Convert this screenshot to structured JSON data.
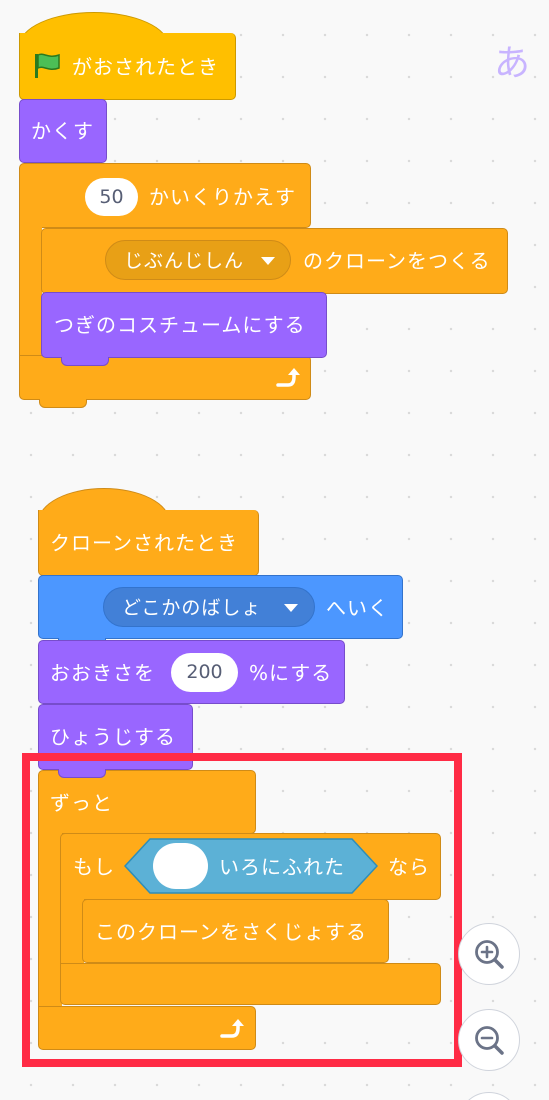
{
  "language_icon": "あ",
  "script1": {
    "flag_hat": {
      "icon": "green-flag-icon",
      "label": "がおされたとき"
    },
    "hide": "かくす",
    "repeat": {
      "count": "50",
      "label": "かいくりかえす"
    },
    "create_clone": {
      "target": "じぶんじしん",
      "label": "のクローンをつくる"
    },
    "next_costume": "つぎのコスチュームにする"
  },
  "script2": {
    "clone_hat": "クローンされたとき",
    "goto": {
      "target": "どこかのばしょ",
      "label": "へいく"
    },
    "set_size": {
      "prefix": "おおきさを",
      "value": "200",
      "suffix": "%にする"
    },
    "show": "ひょうじする",
    "forever": "ずっと",
    "if": {
      "prefix": "もし",
      "touching_label": "いろにふれた",
      "suffix": "なら"
    },
    "delete_clone": "このクローンをさくじょする"
  },
  "colors": {
    "control": "#ffab19",
    "events": "#ffbf00",
    "looks": "#9966ff",
    "motion": "#4c97ff",
    "sensing": "#5cb1d6",
    "highlight": "#ff2b45"
  },
  "zoom": {
    "in_icon": "zoom-in-icon",
    "out_icon": "zoom-out-icon"
  }
}
